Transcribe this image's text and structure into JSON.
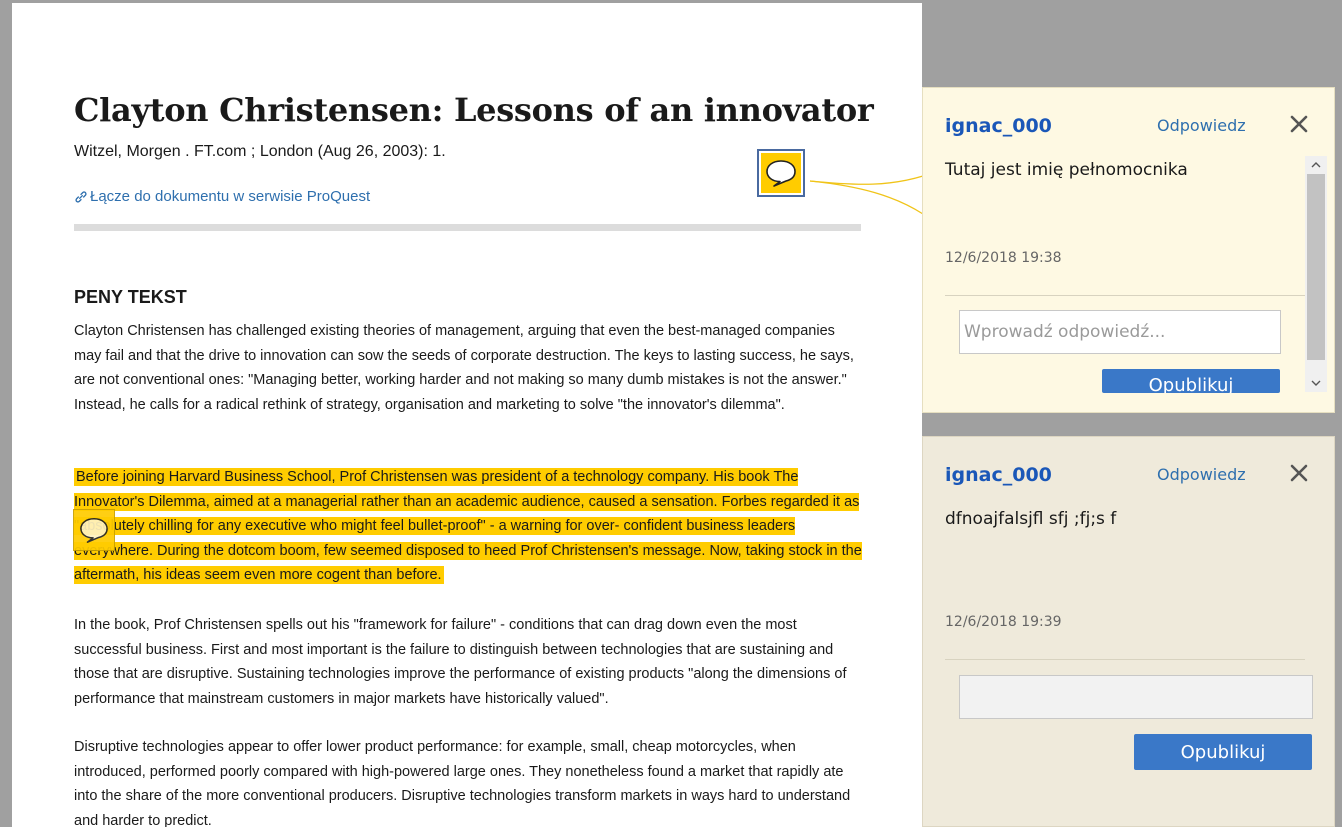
{
  "document": {
    "title": "Clayton Christensen: Lessons of an innovator",
    "meta": "Witzel, Morgen . FT.com ; London (Aug 26, 2003): 1.",
    "link_label": "Łącze do dokumentu w serwisie ProQuest",
    "section_heading": "PENY TEKST",
    "paragraphs": [
      "Clayton Christensen has challenged existing theories of management, arguing that even the best-managed companies may fail and that the drive to innovation can sow the seeds of corporate destruction. The keys to lasting success, he says, are not conventional ones: \"Managing better, working harder and not making so many dumb mistakes is not the answer.\" Instead, he calls for a radical rethink of strategy, organisation and marketing to solve \"the innovator's dilemma\".",
      "Before joining Harvard Business School, Prof Christensen was president of a technology company. His book The Innovator's Dilemma, aimed at a managerial rather than an academic audience, caused a sensation. Forbes regarded it as \"absolutely chilling for any executive who might feel bullet-proof\" - a warning for over- confident business leaders everywhere. During the dotcom boom, few seemed disposed to heed Prof Christensen's message. Now, taking stock in the aftermath, his ideas seem even more cogent than before.",
      "In the book, Prof Christensen spells out his \"framework for failure\" - conditions that can drag down even the most successful business. First and most important is the failure to distinguish between technologies that are sustaining and those that are disruptive. Sustaining technologies improve the performance of existing products \"along the dimensions of performance that mainstream customers in major markets have historically valued\".",
      "Disruptive technologies appear to offer lower product performance: for example, small, cheap motorcycles, when introduced, performed poorly compared with high-powered large ones. They nonetheless found a market that rapidly ate into the share of the more conventional producers. Disruptive technologies transform markets in ways hard to understand and harder to predict."
    ]
  },
  "comments": [
    {
      "author": "ignac_000",
      "reply_label": "Odpowiedz",
      "text": "Tutaj jest imię pełnomocnika",
      "date": "12/6/2018  19:38",
      "input_value": "",
      "input_placeholder": "Wprowadź odpowiedź...",
      "post_label": "Opublikuj"
    },
    {
      "author": "ignac_000",
      "reply_label": "Odpowiedz",
      "text": "dfnoajfalsjfl sfj ;fj;s f",
      "date": "12/6/2018  19:39",
      "input_value": "",
      "input_placeholder": "",
      "post_label": "Opublikuj"
    }
  ],
  "colors": {
    "highlight": "#ffcc00",
    "author": "#1a57b8",
    "link": "#2e6fae",
    "post_button": "#3a78c8",
    "comment_active_bg": "#fef9e3",
    "comment_inactive_bg": "#efeadb"
  },
  "icons": {
    "link": "link-icon",
    "comment_marker": "speech-bubble-icon",
    "close": "close-icon",
    "scroll_up": "chevron-up-icon",
    "scroll_down": "chevron-down-icon"
  }
}
